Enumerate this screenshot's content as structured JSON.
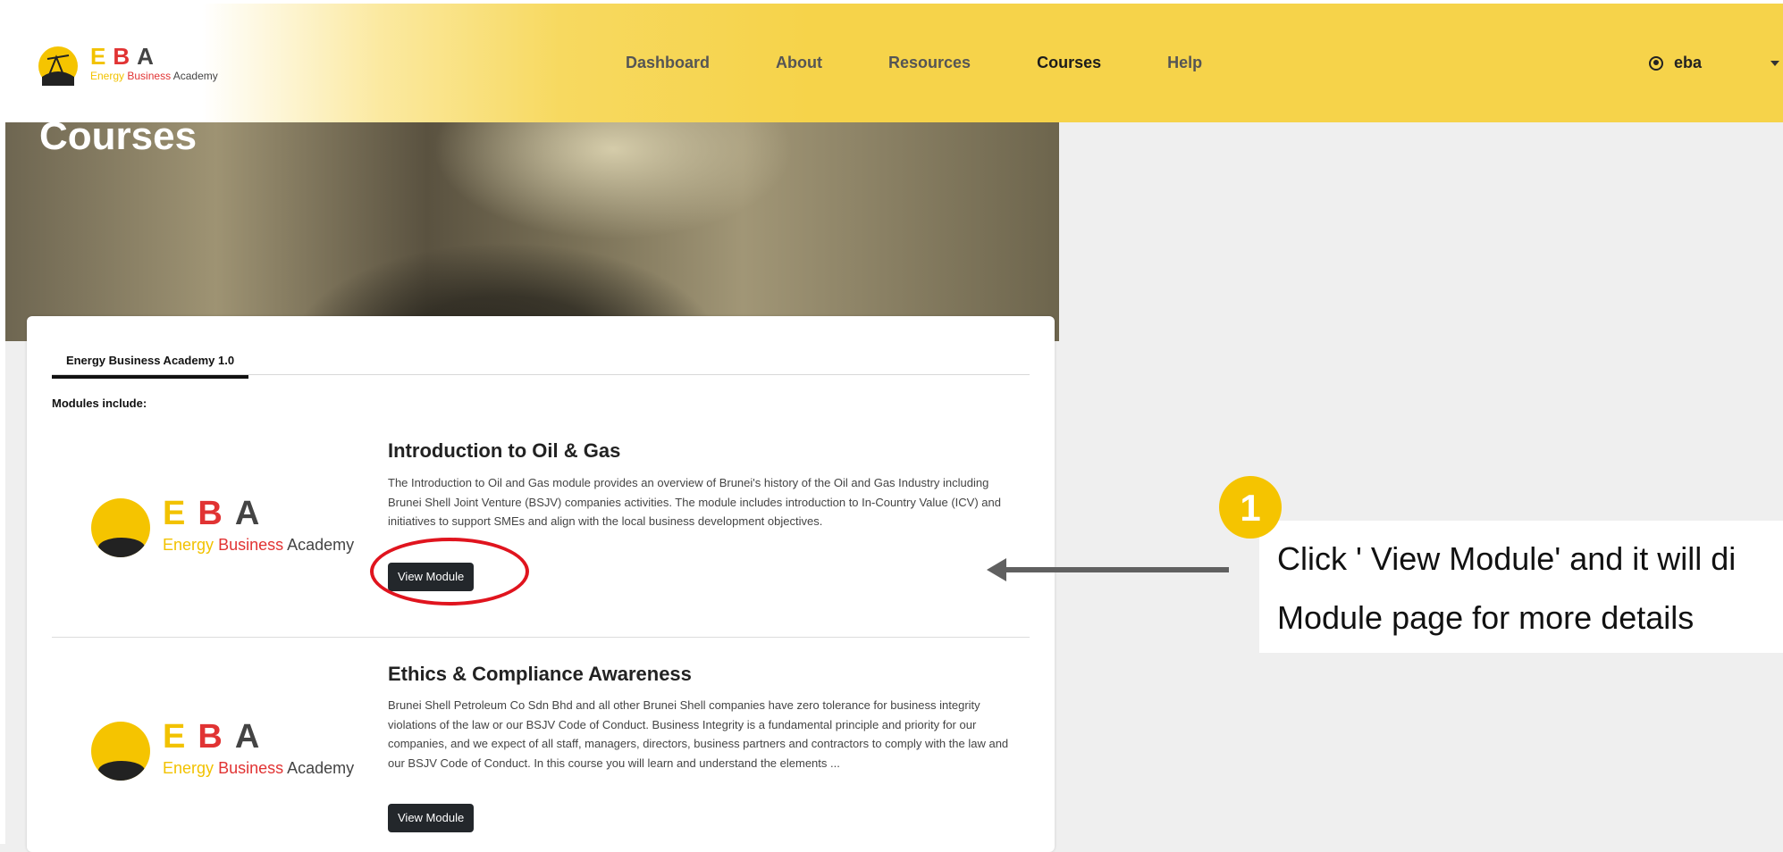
{
  "nav": {
    "logo_letters": [
      "E",
      "B",
      "A"
    ],
    "logo_subtitle": [
      "Energy",
      "Business",
      "Academy"
    ],
    "links": [
      "Dashboard",
      "About",
      "Resources",
      "Courses",
      "Help"
    ],
    "active_link": "Courses",
    "user_name": "eba"
  },
  "hero": {
    "title": "Courses"
  },
  "card": {
    "tab_label": "Energy Business Academy 1.0",
    "modules_label": "Modules include:",
    "modules": [
      {
        "title": "Introduction to Oil & Gas",
        "description": "The Introduction to Oil and Gas module provides an overview of Brunei's history of the Oil and Gas Industry including Brunei Shell Joint Venture (BSJV) companies activities. The module includes introduction to In-Country Value (ICV) and initiatives to support SMEs and align with the local business development objectives.",
        "button_label": "View Module"
      },
      {
        "title": "Ethics & Compliance Awareness",
        "description": "Brunei Shell Petroleum Co Sdn Bhd and all other Brunei Shell companies have zero tolerance for business integrity violations of the law or our BSJV Code of Conduct. Business Integrity is a fundamental principle and priority for our companies, and we expect of all staff, managers, directors, business partners and contractors to comply with the law and our BSJV Code of Conduct. In this course you will learn and understand the elements ...",
        "button_label": "View Module"
      }
    ]
  },
  "annotation": {
    "badge_number": "1",
    "callout_lines": [
      "Click ' View Module' and it will di",
      "Module page for more details"
    ]
  },
  "colors": {
    "nav_yellow": "#f6d34a",
    "brand_yellow": "#f5c400",
    "brand_red": "#e13333",
    "button_dark": "#23272b",
    "highlight_red": "#e0141e"
  }
}
